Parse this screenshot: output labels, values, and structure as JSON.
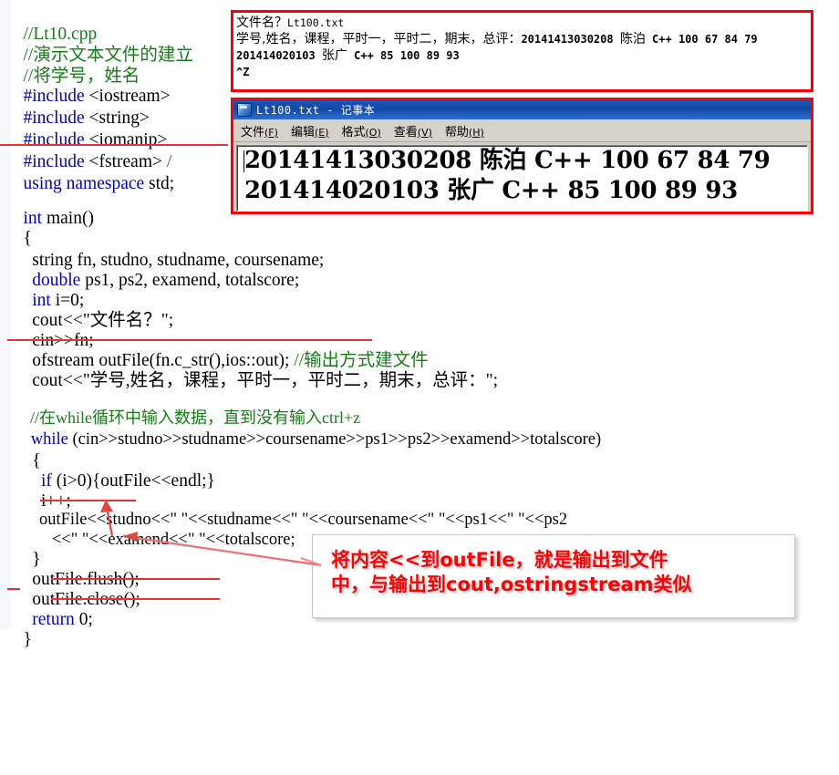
{
  "slide": {
    "title": "Lt10.cpp C++ file output demo slide"
  },
  "code": {
    "lines": [
      {
        "id": "l1",
        "text": "//Lt10.cpp",
        "style": "comment"
      },
      {
        "id": "l2",
        "text": "//演示文本文件的建立",
        "style": "comment"
      },
      {
        "id": "l3",
        "text": "//将学号，姓名",
        "style": "comment"
      },
      {
        "id": "l4",
        "kw": "#include",
        "rest": " <iostream>"
      },
      {
        "id": "l5",
        "kw": "#include",
        "rest": " <string>"
      },
      {
        "id": "l6",
        "kw": "#include",
        "rest": " <iomanip>"
      },
      {
        "id": "l7",
        "kw": "#include",
        "rest": " <fstream>",
        "trail": " /"
      },
      {
        "id": "l8",
        "kw": "using namespace",
        "rest": " std;"
      },
      {
        "id": "l9",
        "text": ""
      },
      {
        "id": "l10",
        "kw": "int",
        "rest": " main()"
      },
      {
        "id": "l11",
        "text": "{"
      },
      {
        "id": "l12",
        "kw": "  string",
        "rest": " fn, studno, studname, coursename;",
        "kwplain": true
      },
      {
        "id": "l13",
        "kw": "  double",
        "rest": " ps1, ps2, examend, totalscore;"
      },
      {
        "id": "l14",
        "kw": "  int",
        "rest": " i=0;"
      },
      {
        "id": "l15",
        "text": "  cout<<\"文件名？\";"
      },
      {
        "id": "l16",
        "text": "  cin>>fn;"
      },
      {
        "id": "l17",
        "text": "  ofstream outFile(fn.c_str(),ios::out); ",
        "comment": "//输出方式建文件"
      },
      {
        "id": "l18",
        "text": "  cout<<\"学号,姓名，课程，平时一，平时二，期末，总评：\";"
      },
      {
        "id": "l19",
        "text": ""
      },
      {
        "id": "l20",
        "text": "  ",
        "comment": "//在while循环中输入数据，直到没有输入ctrl+z"
      },
      {
        "id": "l21",
        "kw": "  while",
        "rest": " (cin>>studno>>studname>>coursename>>ps1>>ps2>>examend>>totalscore)"
      },
      {
        "id": "l22",
        "text": "  {"
      },
      {
        "id": "l23",
        "kw": "    if",
        "rest": " (i>0){outFile<<endl;}"
      },
      {
        "id": "l24",
        "text": "    i++;"
      },
      {
        "id": "l25",
        "text": "    outFile<<studno<<\" \"<<studname<<\" \"<<coursename<<\" \"<<ps1<<\" \"<<ps2"
      },
      {
        "id": "l26",
        "text": "       <<\" \"<<examend<<\" \"<<totalscore;"
      },
      {
        "id": "l27",
        "text": "  }"
      },
      {
        "id": "l28",
        "text": "  outFile.flush();"
      },
      {
        "id": "l29",
        "text": "  outFile.close();"
      },
      {
        "id": "l30",
        "kw": "  return",
        "rest": " 0;"
      },
      {
        "id": "l31",
        "text": "}"
      }
    ],
    "colors": {
      "keyword": "#0000d0",
      "comment": "#157d15",
      "text": "#000000",
      "underline": "#f03030"
    }
  },
  "console": {
    "name": "console-output-window",
    "lines": [
      {
        "cjk": "文件名？",
        "mono": "Lt100.txt"
      },
      {
        "cjk": "学号,姓名，课程，平时一，平时二，期末，总评：",
        "mono": "20141413030208 ",
        "cjk2": "陈泊",
        "mono2": " C++ 100 67 84 79"
      },
      {
        "mono": "201414020103 ",
        "cjk2": "张广",
        "mono2": "  C++ 85 100 89 93"
      },
      {
        "mono": "^Z"
      }
    ],
    "border_color": "#ff0000"
  },
  "notepad": {
    "title": "Lt100.txt - 记事本",
    "menu": [
      {
        "label": "文件",
        "mnemonic": "(F)"
      },
      {
        "label": "编辑",
        "mnemonic": "(E)"
      },
      {
        "label": "格式",
        "mnemonic": "(O)"
      },
      {
        "label": "查看",
        "mnemonic": "(V)"
      },
      {
        "label": "帮助",
        "mnemonic": "(H)"
      }
    ],
    "content_lines": [
      "20141413030208 陈泊 C++ 100 67 84 79",
      "201414020103 张广 C++ 85 100 89 93"
    ],
    "border_color": "#ff0000",
    "titlebar_color": "#1348a8"
  },
  "annotation": {
    "text": "将内容<<到outFile，就是输出到文件\n中，与输出到cout,ostringstream类似",
    "color": "#ff0000"
  }
}
